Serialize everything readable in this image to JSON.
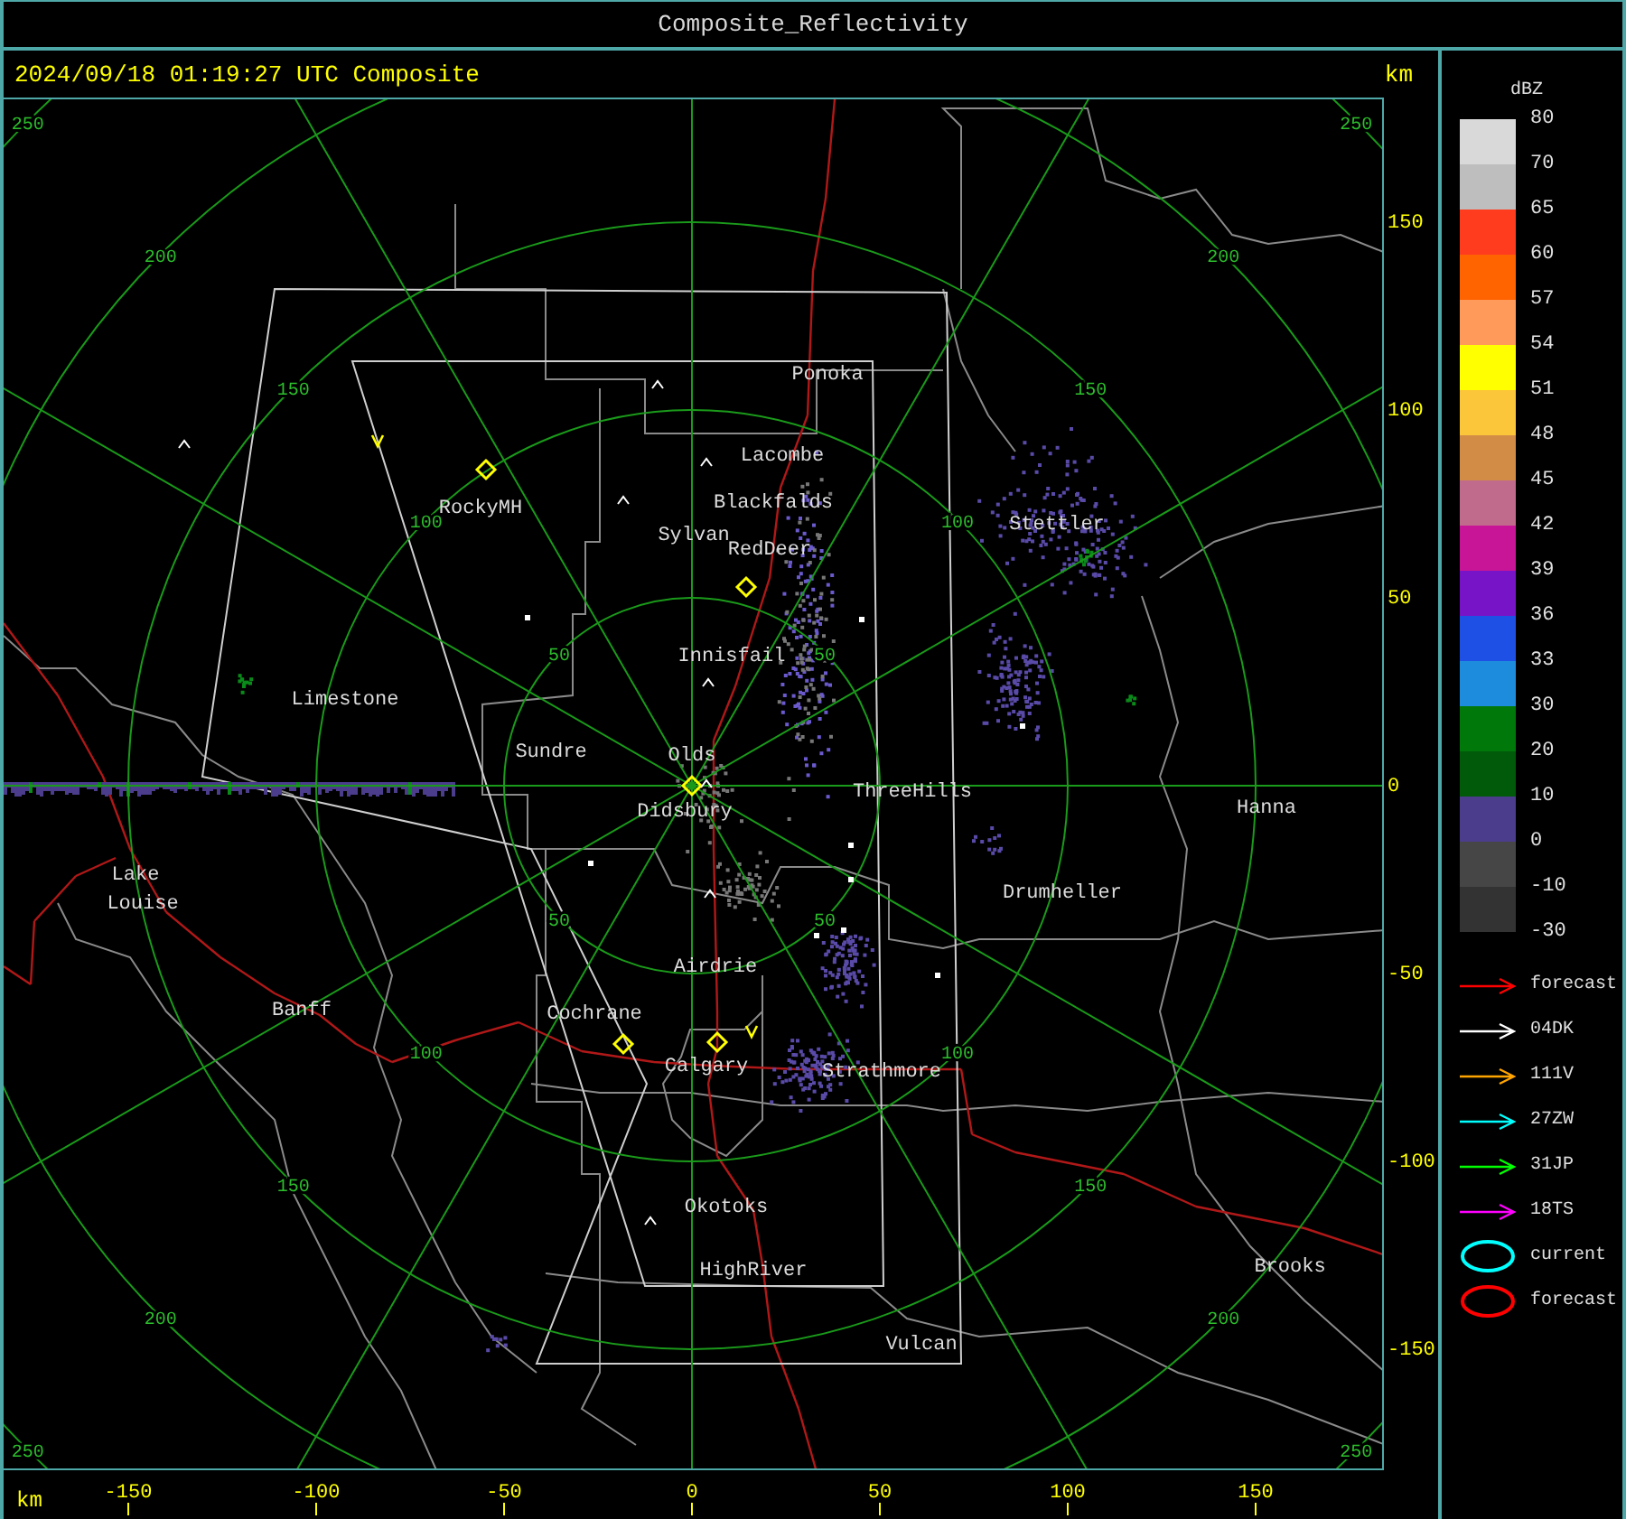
{
  "window": {
    "title": "Composite_Reflectivity"
  },
  "map": {
    "timestamp": "2024/09/18 01:19:27 UTC Composite",
    "unit_top": "km",
    "unit_bottom": "km",
    "range_rings": [
      {
        "labels": [
          "50",
          "50",
          "50",
          "50"
        ]
      },
      {
        "labels": [
          "100",
          "100",
          "100",
          "100"
        ]
      },
      {
        "labels": [
          "150",
          "150",
          "150",
          "150"
        ]
      },
      {
        "labels": [
          "200",
          "200",
          "200",
          "200"
        ]
      },
      {
        "labels": [
          "250",
          "250",
          "250",
          "250"
        ]
      }
    ],
    "cities": [
      {
        "name": "Ponoka"
      },
      {
        "name": "Lacombe"
      },
      {
        "name": "Blackfalds"
      },
      {
        "name": "Sylvan"
      },
      {
        "name": "RedDeer"
      },
      {
        "name": "RockyMH"
      },
      {
        "name": "Stettler"
      },
      {
        "name": "Innisfail"
      },
      {
        "name": "Limestone"
      },
      {
        "name": "Sundre"
      },
      {
        "name": "Olds"
      },
      {
        "name": "ThreeHills"
      },
      {
        "name": "Didsbury"
      },
      {
        "name": "Hanna"
      },
      {
        "name": "Lake"
      },
      {
        "name": "Louise"
      },
      {
        "name": "Drumheller"
      },
      {
        "name": "Airdrie"
      },
      {
        "name": "Banff"
      },
      {
        "name": "Cochrane"
      },
      {
        "name": "Calgary"
      },
      {
        "name": "Strathmore"
      },
      {
        "name": "Okotoks"
      },
      {
        "name": "HighRiver"
      },
      {
        "name": "Brooks"
      },
      {
        "name": "Vulcan"
      }
    ],
    "y_ticks": [
      "150",
      "100",
      "50",
      "0",
      "-50",
      "-100",
      "-150"
    ],
    "x_ticks": [
      "-150",
      "-100",
      "-50",
      "0",
      "50",
      "100",
      "150"
    ]
  },
  "legend": {
    "title": "dBZ",
    "bins": [
      {
        "label": "80",
        "color": "#d9d9d9"
      },
      {
        "label": "70",
        "color": "#bebebe"
      },
      {
        "label": "65",
        "color": "#ff3c1e"
      },
      {
        "label": "60",
        "color": "#ff6400"
      },
      {
        "label": "57",
        "color": "#ff9a5a"
      },
      {
        "label": "54",
        "color": "#ffff00"
      },
      {
        "label": "51",
        "color": "#fcc63a"
      },
      {
        "label": "48",
        "color": "#d28c46"
      },
      {
        "label": "45",
        "color": "#c06a8c"
      },
      {
        "label": "42",
        "color": "#c81496"
      },
      {
        "label": "39",
        "color": "#7814c8"
      },
      {
        "label": "36",
        "color": "#1e50e6"
      },
      {
        "label": "33",
        "color": "#1e8cdc"
      },
      {
        "label": "30",
        "color": "#00780a"
      },
      {
        "label": "20",
        "color": "#005a0a"
      },
      {
        "label": "10",
        "color": "#4b3c8c"
      },
      {
        "label": "0",
        "color": "#464646"
      },
      {
        "label": "-10",
        "color": "#333333"
      }
    ],
    "bottom_label": "-30",
    "tracks": [
      {
        "kind": "arrow",
        "label": "forecast",
        "color": "#ff0000"
      },
      {
        "kind": "arrow",
        "label": "04DK",
        "color": "#ffffff"
      },
      {
        "kind": "arrow",
        "label": "111V",
        "color": "#ffa500"
      },
      {
        "kind": "arrow",
        "label": "27ZW",
        "color": "#00ffff"
      },
      {
        "kind": "arrow",
        "label": "31JP",
        "color": "#00ff00"
      },
      {
        "kind": "arrow",
        "label": "18TS",
        "color": "#ff00ff"
      },
      {
        "kind": "ellipse",
        "label": "current",
        "color": "#00ffff"
      },
      {
        "kind": "ellipse",
        "label": "forecast",
        "color": "#ff0000"
      }
    ]
  }
}
